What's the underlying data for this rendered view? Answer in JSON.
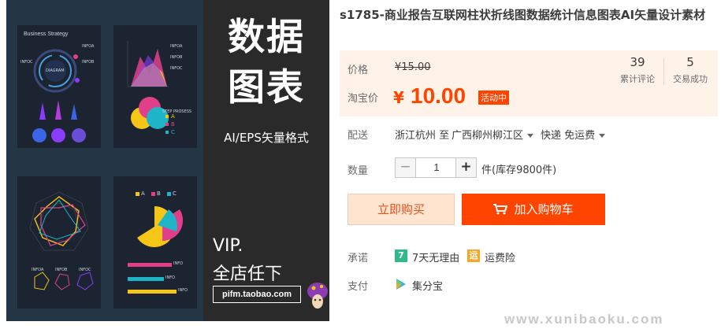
{
  "product_image": {
    "banner_line1": "数据",
    "banner_line2": "图表",
    "banner_format": "AI/EPS矢量格式",
    "banner_vip": "VIP.",
    "banner_shop": "全店任下",
    "banner_url": "pifm.taobao.com",
    "card1_title": "Business Strategy",
    "card1_center": "DIAGRAM",
    "card1_infoa": "INFOA",
    "card1_infob": "INFOB",
    "card1_infoc": "INFOC",
    "card2_infoa": "INFOA",
    "card2_infob": "INFOB",
    "card2_infoc": "INFOC",
    "card2_step": "STEP PROSESS",
    "card2_legend": [
      "A",
      "B",
      "C"
    ],
    "card4_legend": [
      "A",
      "B",
      "C"
    ],
    "card3_labels": [
      "INFOA",
      "INFOB",
      "INFOC"
    ],
    "card4_bar_labels": [
      "INFO",
      "INFO",
      "INFO"
    ]
  },
  "title": "s1785-商业报告互联网柱状折线图数据统计信息图表AI矢量设计素材",
  "price": {
    "label": "价格",
    "old_value": "¥15.00",
    "taobao_label": "淘宝价",
    "currency": "¥",
    "value": "10.00",
    "promo_tag": "活动中"
  },
  "stats": [
    {
      "value": "39",
      "label": "累计评论"
    },
    {
      "value": "5",
      "label": "交易成功"
    }
  ],
  "shipping": {
    "label": "配送",
    "origin": "浙江杭州 至",
    "destination": "广西柳州柳江区",
    "method": "快递 免运费"
  },
  "quantity": {
    "label": "数量",
    "value": "1",
    "minus": "−",
    "plus": "+",
    "stock": "件(库存9800件)"
  },
  "buttons": {
    "buy_now": "立即购买",
    "add_to_cart": "加入购物车"
  },
  "promise": {
    "label": "承诺",
    "items": [
      {
        "icon_text": "7",
        "text": "7天无理由",
        "color": "#2ebb8a"
      },
      {
        "icon_text": "运",
        "text": "运费险",
        "color": "#f5a623"
      }
    ]
  },
  "payment": {
    "label": "支付",
    "method": "集分宝"
  },
  "watermark": "www.xunibaoku.com",
  "colors": {
    "accent": "#ff4400",
    "price_bg": "#fff2e8",
    "buy_bg": "#ffe4d0"
  }
}
